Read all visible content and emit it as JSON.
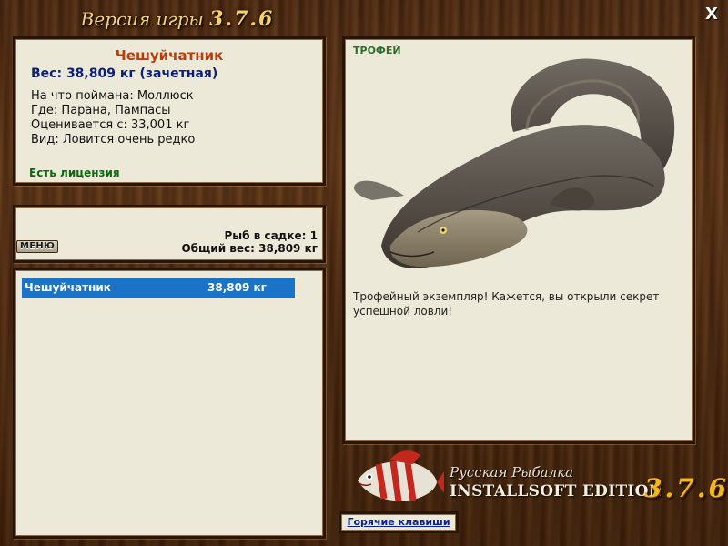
{
  "window": {
    "title_prefix": "Версия игры",
    "title_version": "3.7.6",
    "close_label": "X"
  },
  "fish_info": {
    "name": "Чешуйчатник",
    "weight": "Вес: 38,809 кг (зачетная)",
    "caught_on": "На что поймана: Моллюск",
    "location": "Где: Парана, Пампасы",
    "rated_from": "Оценивается с: 33,001 кг",
    "species_note": "Вид: Ловится очень редко",
    "license": "Есть лицензия"
  },
  "keep_net": {
    "count": "Рыб в садке: 1",
    "total_weight": "Общий вес: 38,809 кг",
    "menu_label": "МЕНЮ",
    "rows": [
      {
        "name": "Чешуйчатник",
        "weight": "38,809 кг"
      }
    ]
  },
  "trophy": {
    "tag": "ТРОФЕЙ",
    "description": "Трофейный экземпляр! Кажется, вы открыли секрет успешной ловли!",
    "image_icon": "lungfish-image"
  },
  "logo": {
    "line1": "Русская Рыбалка",
    "line2": "INSTALLSOFT EDITION",
    "version": "3.7.6"
  },
  "hotkeys_label": "Горячие клавиши",
  "colors": {
    "fish_name": "#b83c0c",
    "weight": "#0a1f7a",
    "license": "#0b6a10",
    "trophy_tag": "#2f6b2c",
    "selection": "#1b73c7",
    "panel": "#ece9d8",
    "logo_version": "#f0b81c"
  }
}
